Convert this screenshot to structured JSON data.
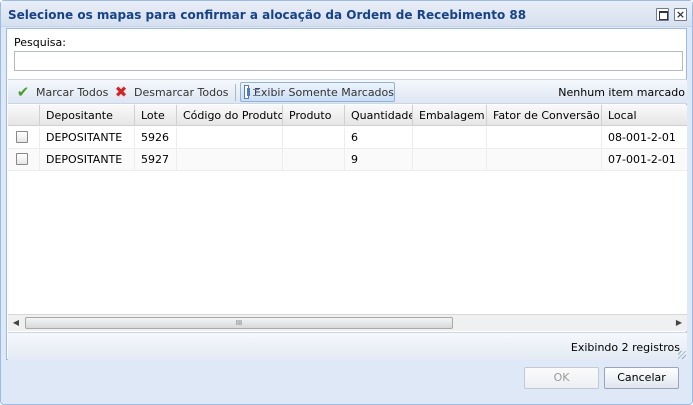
{
  "window": {
    "title": "Selecione os mapas para confirmar a alocação da Ordem de Recebimento 88",
    "close_glyph": "×"
  },
  "search": {
    "label": "Pesquisa:",
    "value": "",
    "placeholder": ""
  },
  "toolbar": {
    "check_all_label": "Marcar Todos",
    "uncheck_all_label": "Desmarcar Todos",
    "show_checked_label": "Exibir Somente Marcados",
    "status_text": "Nenhum item marcado",
    "check_icon": "✔",
    "cross_icon": "✖"
  },
  "grid": {
    "columns": [
      "Depositante",
      "Lote",
      "Código do Produto",
      "Produto",
      "Quantidade",
      "Embalagem",
      "Fator de Conversão",
      "Local"
    ],
    "rows": [
      {
        "checked": false,
        "depositante": "DEPOSITANTE",
        "lote": "5926",
        "codigo": "",
        "produto": "",
        "quantidade": "6",
        "embalagem": "",
        "fator": "",
        "local": "08-001-2-01"
      },
      {
        "checked": false,
        "depositante": "DEPOSITANTE",
        "lote": "5927",
        "codigo": "",
        "produto": "",
        "quantidade": "9",
        "embalagem": "",
        "fator": "",
        "local": "07-001-2-01"
      }
    ]
  },
  "scrollbar": {
    "left_arrow": "◀",
    "right_arrow": "▶",
    "thumb_grip": "III"
  },
  "paging": {
    "display_text": "Exibindo 2 registros"
  },
  "footer": {
    "ok_label": "OK",
    "cancel_label": "Cancelar"
  },
  "colors": {
    "title_text": "#15428b",
    "window_frame": "#99bbe8",
    "check_icon": "#49a02c",
    "cross_icon": "#d42424"
  }
}
